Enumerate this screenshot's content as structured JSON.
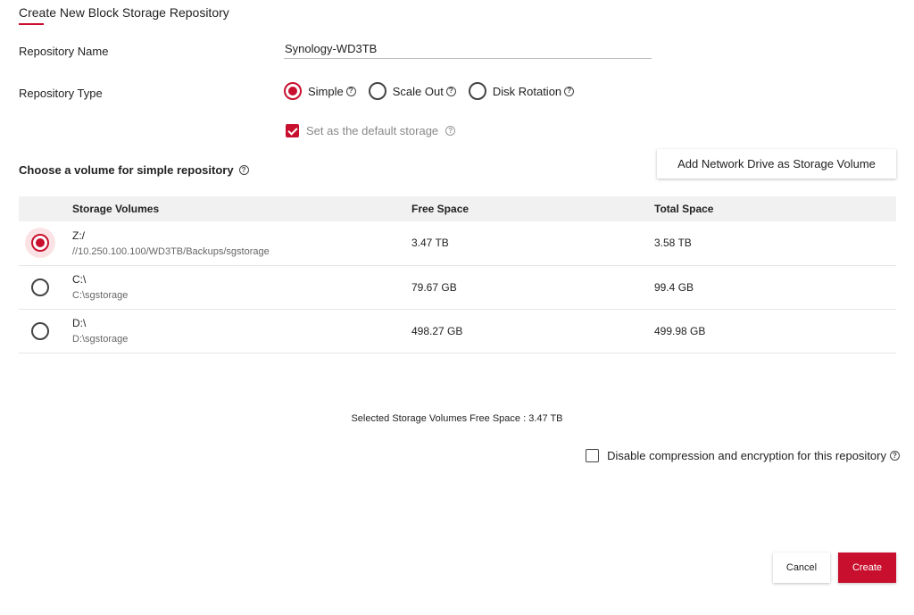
{
  "page": {
    "title": "Create New Block Storage Repository"
  },
  "repo_name": {
    "label": "Repository Name",
    "value": "Synology-WD3TB"
  },
  "repo_type": {
    "label": "Repository Type",
    "options": [
      {
        "label": "Simple",
        "selected": true
      },
      {
        "label": "Scale Out",
        "selected": false
      },
      {
        "label": "Disk Rotation",
        "selected": false
      }
    ]
  },
  "default_storage": {
    "label": "Set as the default storage",
    "checked": true
  },
  "volumes": {
    "section_title": "Choose a volume for simple repository",
    "add_drive_label": "Add Network Drive as Storage Volume",
    "columns": [
      "Storage Volumes",
      "Free Space",
      "Total Space"
    ],
    "rows": [
      {
        "name": "Z:/",
        "path": "//10.250.100.100/WD3TB/Backups/sgstorage",
        "free": "3.47 TB",
        "total": "3.58 TB",
        "selected": true
      },
      {
        "name": "C:\\",
        "path": "C:\\sgstorage",
        "free": "79.67 GB",
        "total": "99.4 GB",
        "selected": false
      },
      {
        "name": "D:\\",
        "path": "D:\\sgstorage",
        "free": "498.27 GB",
        "total": "499.98 GB",
        "selected": false
      }
    ]
  },
  "summary": "Selected Storage Volumes Free Space : 3.47 TB",
  "disable_compression": {
    "label": "Disable compression and encryption for this repository",
    "checked": false
  },
  "buttons": {
    "cancel": "Cancel",
    "create": "Create"
  },
  "icons": {
    "help": "?"
  },
  "colors": {
    "accent": "#c8102e",
    "header_bg": "#f1f1f1"
  }
}
